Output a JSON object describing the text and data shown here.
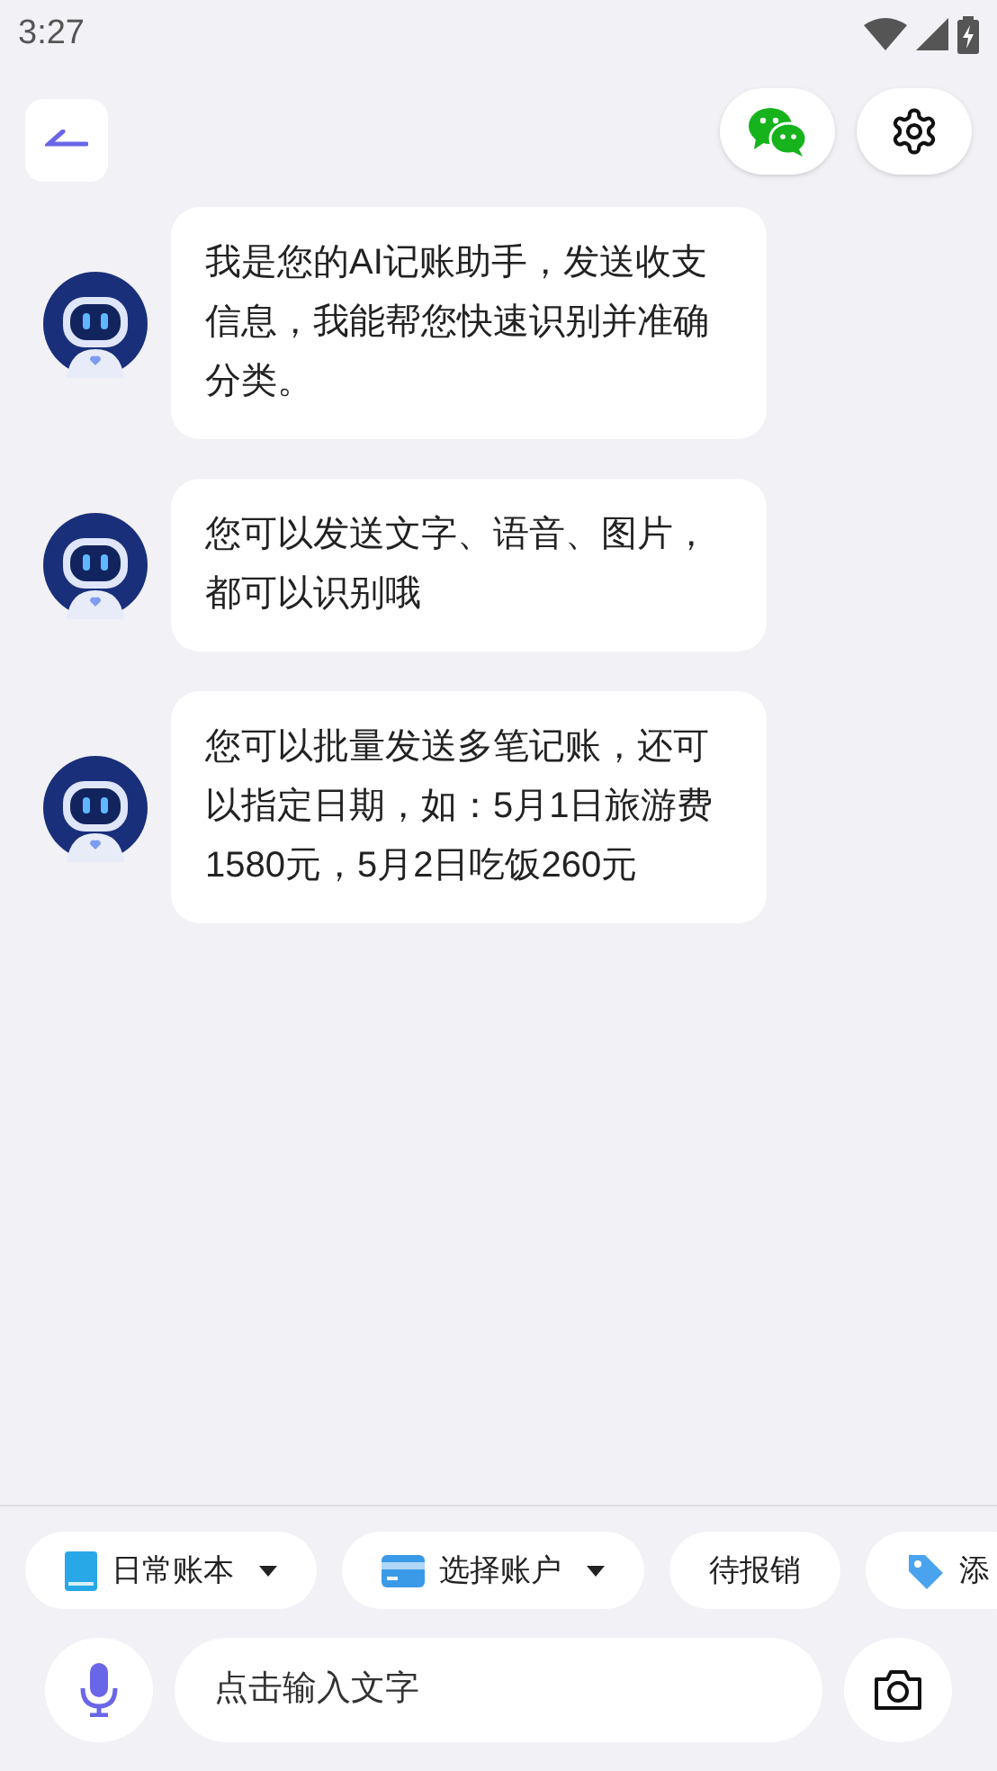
{
  "status_bar": {
    "time": "3:27"
  },
  "messages": [
    {
      "text": "我是您的AI记账助手，发送收支信息，我能帮您快速识别并准确分类。"
    },
    {
      "text": "您可以发送文字、语音、图片，都可以识别哦"
    },
    {
      "text": "您可以批量发送多笔记账，还可以指定日期，如：5月1日旅游费1580元，5月2日吃饭260元"
    }
  ],
  "chips": [
    {
      "label": "日常账本",
      "kind": "book",
      "dropdown": true
    },
    {
      "label": "选择账户",
      "kind": "card",
      "dropdown": true
    },
    {
      "label": "待报销",
      "kind": "plain",
      "dropdown": false
    },
    {
      "label": "添",
      "kind": "tag",
      "dropdown": false
    }
  ],
  "input": {
    "placeholder": "点击输入文字"
  }
}
